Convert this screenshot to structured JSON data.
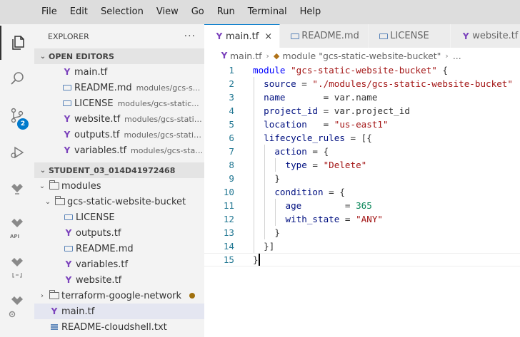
{
  "menubar": {
    "items": [
      "File",
      "Edit",
      "Selection",
      "View",
      "Go",
      "Run",
      "Terminal",
      "Help"
    ]
  },
  "activity": {
    "scm_badge": "2",
    "api_label": "API"
  },
  "explorer": {
    "title": "EXPLORER",
    "more": "···",
    "open_editors": {
      "header": "OPEN EDITORS",
      "items": [
        {
          "name": "main.tf",
          "desc": "",
          "icon": "terraform"
        },
        {
          "name": "README.md",
          "desc": "modules/gcs-s...",
          "icon": "markdown"
        },
        {
          "name": "LICENSE",
          "desc": "modules/gcs-static...",
          "icon": "license"
        },
        {
          "name": "website.tf",
          "desc": "modules/gcs-static...",
          "icon": "terraform"
        },
        {
          "name": "outputs.tf",
          "desc": "modules/gcs-static-...",
          "icon": "terraform"
        },
        {
          "name": "variables.tf",
          "desc": "modules/gcs-stati...",
          "icon": "terraform"
        }
      ]
    },
    "workspace": {
      "header": "STUDENT_03_014D41972468",
      "tree": [
        {
          "name": "modules",
          "type": "folder"
        },
        {
          "name": "gcs-static-website-bucket",
          "type": "folder"
        },
        {
          "name": "LICENSE",
          "type": "license"
        },
        {
          "name": "outputs.tf",
          "type": "terraform"
        },
        {
          "name": "README.md",
          "type": "markdown"
        },
        {
          "name": "variables.tf",
          "type": "terraform"
        },
        {
          "name": "website.tf",
          "type": "terraform"
        },
        {
          "name": "terraform-google-network",
          "type": "folder",
          "modified": true
        },
        {
          "name": "main.tf",
          "type": "terraform",
          "selected": true
        },
        {
          "name": "README-cloudshell.txt",
          "type": "text"
        }
      ]
    }
  },
  "tabs": [
    {
      "label": "main.tf",
      "icon": "terraform",
      "active": true,
      "close": "×"
    },
    {
      "label": "README.md",
      "icon": "markdown"
    },
    {
      "label": "LICENSE",
      "icon": "license"
    },
    {
      "label": "website.tf",
      "icon": "terraform"
    }
  ],
  "breadcrumb": {
    "file": "main.tf",
    "symbol": "module \"gcs-static-website-bucket\"",
    "more": "..."
  },
  "editor": {
    "line_numbers": [
      "1",
      "2",
      "3",
      "4",
      "5",
      "6",
      "7",
      "8",
      "9",
      "10",
      "11",
      "12",
      "13",
      "14",
      "15"
    ],
    "lines": [
      [
        [
          "kw",
          "module"
        ],
        [
          "t",
          " "
        ],
        [
          "str",
          "\"gcs-static-website-bucket\""
        ],
        [
          "t",
          " {"
        ]
      ],
      [
        [
          "t",
          "  "
        ],
        [
          "prop",
          "source"
        ],
        [
          "t",
          " = "
        ],
        [
          "str",
          "\"./modules/gcs-static-website-bucket\""
        ]
      ],
      [
        [
          "t",
          "  "
        ],
        [
          "prop",
          "name"
        ],
        [
          "t",
          "       = var.name"
        ]
      ],
      [
        [
          "t",
          "  "
        ],
        [
          "prop",
          "project_id"
        ],
        [
          "t",
          " = var.project_id"
        ]
      ],
      [
        [
          "t",
          "  "
        ],
        [
          "prop",
          "location"
        ],
        [
          "t",
          "   = "
        ],
        [
          "str",
          "\"us-east1\""
        ]
      ],
      [
        [
          "t",
          "  "
        ],
        [
          "prop",
          "lifecycle_rules"
        ],
        [
          "t",
          " = [{"
        ]
      ],
      [
        [
          "t",
          "    "
        ],
        [
          "prop",
          "action"
        ],
        [
          "t",
          " = {"
        ]
      ],
      [
        [
          "t",
          "      "
        ],
        [
          "prop",
          "type"
        ],
        [
          "t",
          " = "
        ],
        [
          "str",
          "\"Delete\""
        ]
      ],
      [
        [
          "t",
          "    }"
        ]
      ],
      [
        [
          "t",
          "    "
        ],
        [
          "prop",
          "condition"
        ],
        [
          "t",
          " = {"
        ]
      ],
      [
        [
          "t",
          "      "
        ],
        [
          "prop",
          "age"
        ],
        [
          "t",
          "        = "
        ],
        [
          "num",
          "365"
        ]
      ],
      [
        [
          "t",
          "      "
        ],
        [
          "prop",
          "with_state"
        ],
        [
          "t",
          " = "
        ],
        [
          "str",
          "\"ANY\""
        ]
      ],
      [
        [
          "t",
          "    }"
        ]
      ],
      [
        [
          "t",
          "  }]"
        ]
      ],
      [
        [
          "t",
          "}"
        ]
      ]
    ]
  },
  "colors": {
    "accent": "#007acc",
    "terraform": "#7b42bc",
    "keyword": "#0000ff",
    "string": "#a31515",
    "number": "#098658"
  }
}
